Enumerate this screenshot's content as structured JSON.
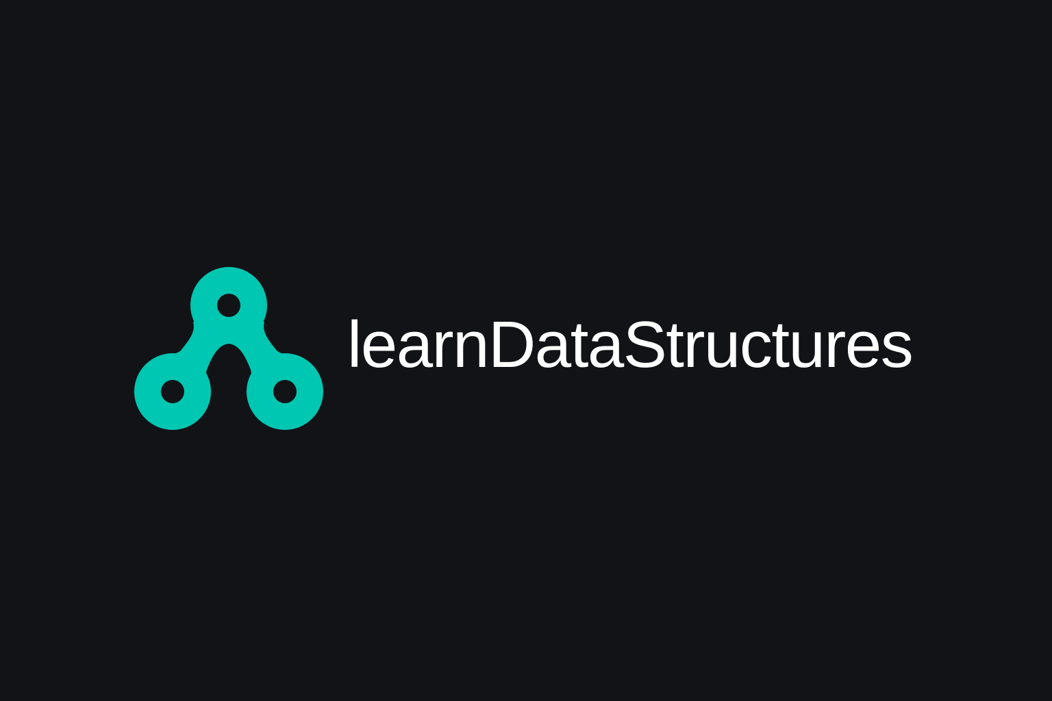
{
  "brand": {
    "name": "learnDataStructures",
    "accent_color": "#00C7B1",
    "text_color": "#FFFFFF",
    "background_color": "#121317",
    "logo_icon": "connected-nodes-icon"
  }
}
